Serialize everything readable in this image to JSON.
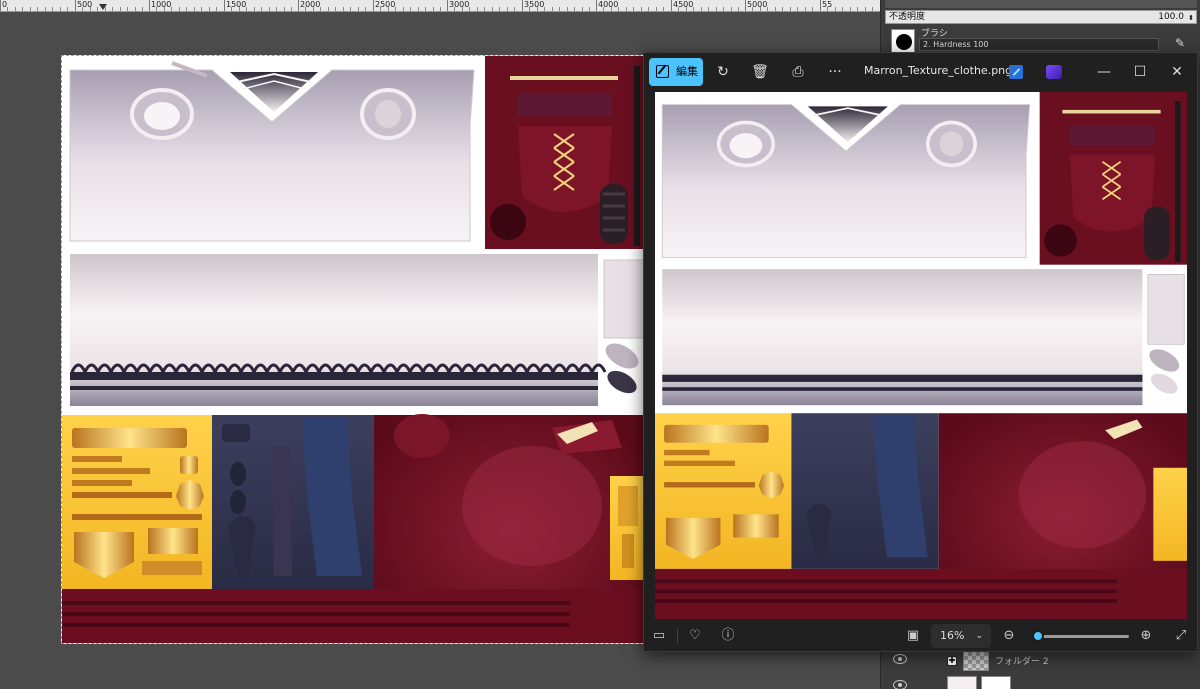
{
  "ruler": {
    "labels": [
      "0",
      "500",
      "1000",
      "1500",
      "2000",
      "2500",
      "3000",
      "3500",
      "4000",
      "4500",
      "5000",
      "55"
    ]
  },
  "layers_panel": {
    "opacity_label": "不透明度",
    "opacity_value": "100.0",
    "brush_label": "ブラシ",
    "brush_name": "2. Hardness 100",
    "layer_name": "フォルダー 2"
  },
  "viewer": {
    "edit_label": "編集",
    "filename": "Marron_Texture_clothe.png",
    "zoom_value": "16%",
    "zoom_level": 0.05,
    "icons": [
      "rotate-icon",
      "delete-icon",
      "print-icon",
      "more-icon"
    ]
  }
}
